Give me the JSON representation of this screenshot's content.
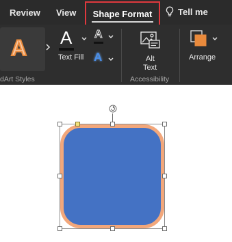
{
  "tabs": {
    "review": "Review",
    "view": "View",
    "shape_format": "Shape Format",
    "tell_me": "Tell me"
  },
  "ribbon": {
    "wordart_group_label": "dArt Styles",
    "wordart_sample_letter": "A",
    "text_fill_label": "Text Fill",
    "text_fill_letter": "A",
    "text_outline_letter": "A",
    "text_effects_letter": "A",
    "alt_text_label_line1": "Alt",
    "alt_text_label_line2": "Text",
    "accessibility_group_label": "Accessibility",
    "arrange_label": "Arrange"
  },
  "colors": {
    "shape_fill": "#4472c4",
    "shape_outline": "#f2a77b",
    "active_tab_highlight": "#e0393e",
    "wordart_orange": "#e98a3c",
    "text_effects_blue": "#4a8ee8"
  }
}
